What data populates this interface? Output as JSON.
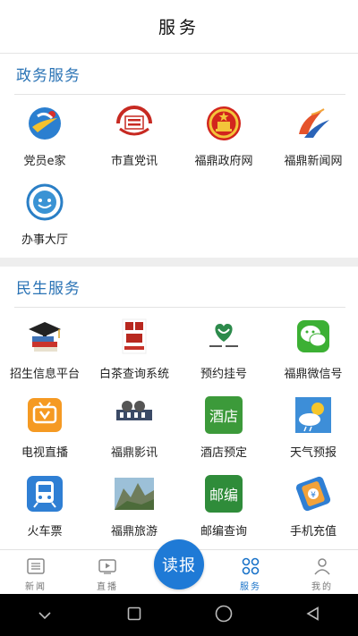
{
  "header": {
    "title": "服务"
  },
  "sections": [
    {
      "title": "政务服务",
      "items": [
        {
          "label": "党员e家",
          "icon": "party-member-home-icon"
        },
        {
          "label": "市直党讯",
          "icon": "city-party-news-icon"
        },
        {
          "label": "福鼎政府网",
          "icon": "national-emblem-icon"
        },
        {
          "label": "福鼎新闻网",
          "icon": "fuding-news-icon"
        },
        {
          "label": "办事大厅",
          "icon": "service-hall-icon"
        }
      ]
    },
    {
      "title": "民生服务",
      "items": [
        {
          "label": "招生信息平台",
          "icon": "graduation-icon"
        },
        {
          "label": "白茶查询系统",
          "icon": "white-tea-icon"
        },
        {
          "label": "预约挂号",
          "icon": "hospital-icon"
        },
        {
          "label": "福鼎微信号",
          "icon": "wechat-icon"
        },
        {
          "label": "电视直播",
          "icon": "tv-icon"
        },
        {
          "label": "福鼎影讯",
          "icon": "cinema-icon"
        },
        {
          "label": "酒店预定",
          "icon": "hotel-icon",
          "text": "酒店"
        },
        {
          "label": "天气预报",
          "icon": "weather-icon"
        },
        {
          "label": "火车票",
          "icon": "train-icon"
        },
        {
          "label": "福鼎旅游",
          "icon": "tourism-icon"
        },
        {
          "label": "邮编查询",
          "icon": "postcode-icon",
          "text": "邮编"
        },
        {
          "label": "手机充值",
          "icon": "phone-recharge-icon"
        }
      ]
    }
  ],
  "tabbar": {
    "items": [
      {
        "label": "新闻",
        "icon": "news-icon"
      },
      {
        "label": "直播",
        "icon": "live-icon"
      },
      {
        "label": "读报",
        "icon": "read-paper-button"
      },
      {
        "label": "服务",
        "icon": "service-grid-icon",
        "active": true
      },
      {
        "label": "我的",
        "icon": "profile-icon"
      }
    ]
  },
  "colors": {
    "accent": "#1f7ad6",
    "section_title": "#2a73b5",
    "active_tab": "#1a73c9"
  }
}
